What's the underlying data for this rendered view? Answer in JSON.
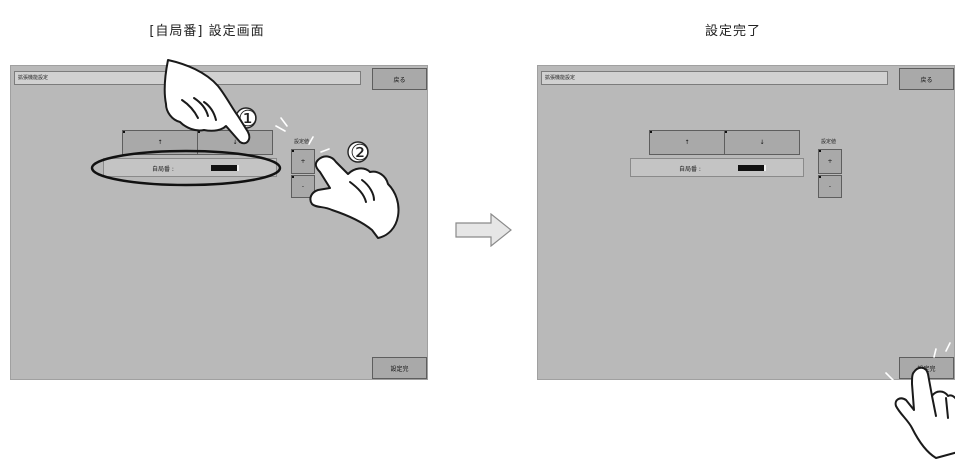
{
  "left_panel": {
    "caption": "[自局番] 設定画面",
    "title_field": "拡張機能設定",
    "back_button": "戻る",
    "up_button": "↑",
    "down_button": "↓",
    "station_label": "自局番 :",
    "setting_label": "設定値",
    "plus_button": "+",
    "minus_button": "-",
    "done_button": "設定完",
    "step1": "①",
    "step2": "②"
  },
  "right_panel": {
    "caption": "設定完了",
    "title_field": "拡張機能設定",
    "back_button": "戻る",
    "up_button": "↑",
    "down_button": "↓",
    "station_label": "自局番 :",
    "setting_label": "設定値",
    "plus_button": "+",
    "minus_button": "-",
    "done_button": "設定完"
  }
}
